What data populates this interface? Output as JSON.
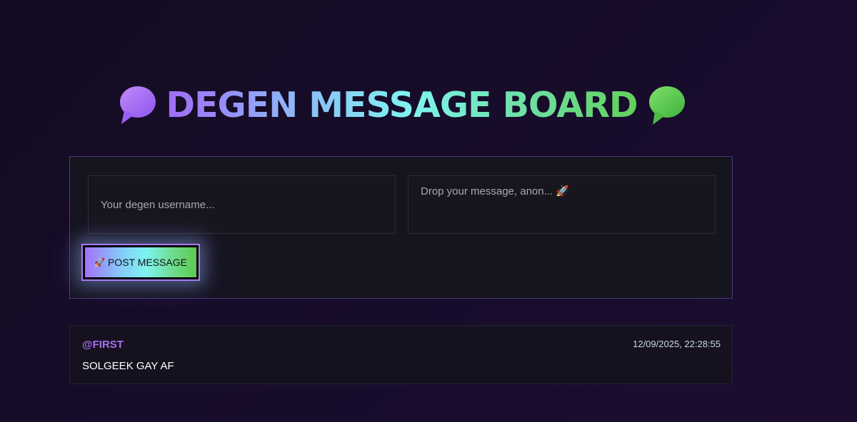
{
  "header": {
    "title": "DEGEN MESSAGE BOARD",
    "left_icon": "purple-speech-bubble-icon",
    "right_icon": "green-speech-bubble-icon"
  },
  "form": {
    "username_placeholder": "Your degen username...",
    "username_value": "",
    "message_placeholder": "Drop your message, anon... 🚀",
    "message_value": "",
    "post_button_icon": "🚀",
    "post_button_label": "POST MESSAGE"
  },
  "messages": [
    {
      "username": "@FIRST",
      "timestamp": "12/09/2025, 22:28:55",
      "text": "SOLGEEK GAY AF"
    }
  ],
  "colors": {
    "background": "#160b27",
    "accent_purple": "#a76ef2",
    "accent_cyan": "#7ff4f0",
    "accent_green": "#62d05a",
    "card_border": "#4a3a75"
  }
}
